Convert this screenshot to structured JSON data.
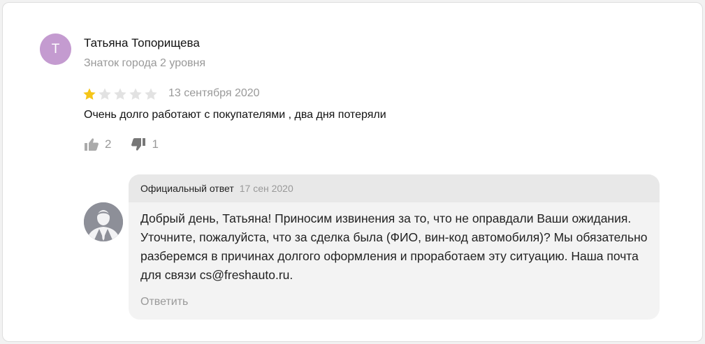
{
  "review": {
    "avatar_letter": "T",
    "author_name": "Татьяна Топорищева",
    "author_level": "Знаток города 2 уровня",
    "rating": 1,
    "rating_max": 5,
    "date": "13 сентября 2020",
    "text": "Очень долго работают с покупателями , два дня потеряли",
    "likes": "2",
    "dislikes": "1"
  },
  "official_reply": {
    "label": "Официальный ответ",
    "date": "17 сен 2020",
    "text": "Добрый день, Татьяна! Приносим извинения за то, что не оправдали Ваши ожидания. Уточните, пожалуйста, что за сделка была (ФИО,  вин-код автомобиля)? Мы обязательно разберемся в причинах долгого оформления и проработаем эту ситуацию. Наша почта для связи cs@freshauto.ru.",
    "reply_button": "Ответить"
  },
  "colors": {
    "avatar_bg": "#c49bd0",
    "star_filled": "#f5c518",
    "star_empty": "#e2e2e2",
    "muted_text": "#999999",
    "reply_header_bg": "#e8e8e8",
    "reply_body_bg": "#f3f3f3"
  },
  "icons": {
    "like": "thumbs-up-icon",
    "dislike": "thumbs-down-icon",
    "reply_avatar": "business-person-icon"
  }
}
